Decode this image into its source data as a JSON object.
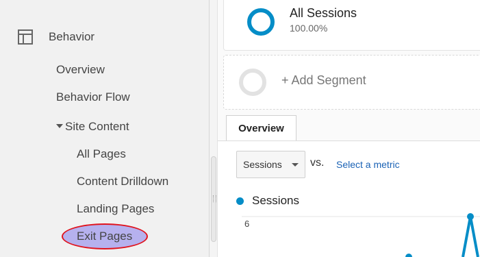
{
  "sidebar": {
    "section_label": "Behavior",
    "section_icon": "layout-icon",
    "items": [
      {
        "label": "Overview"
      },
      {
        "label": "Behavior Flow"
      },
      {
        "label": "Site Content"
      },
      {
        "label": "All Pages"
      },
      {
        "label": "Content Drilldown"
      },
      {
        "label": "Landing Pages"
      },
      {
        "label": "Exit Pages"
      }
    ]
  },
  "segments": {
    "active": {
      "name": "All Sessions",
      "percent": "100.00%",
      "color": "#058dc7"
    },
    "add_label": "+ Add Segment"
  },
  "tabs": [
    {
      "label": "Overview"
    }
  ],
  "controls": {
    "metric_select": "Sessions",
    "vs_label": "vs.",
    "select_metric_link": "Select a metric"
  },
  "chart_data": {
    "type": "line",
    "series": [
      {
        "name": "Sessions",
        "color": "#058dc7"
      }
    ],
    "y_tick_labels": [
      "6"
    ]
  },
  "colors": {
    "highlight_fill": "#b6b1ee",
    "highlight_border": "#e0141e",
    "link": "#1a62b5"
  }
}
